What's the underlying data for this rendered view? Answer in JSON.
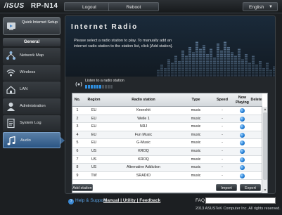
{
  "header": {
    "logo": "/ISUS",
    "model": "RP-N14",
    "logout_label": "Logout",
    "reboot_label": "Reboot",
    "language": "English"
  },
  "sidebar": {
    "quick_setup": "Quick Internet Setup",
    "general_label": "General",
    "items": [
      {
        "label": "Network Map",
        "icon": "network-map-icon"
      },
      {
        "label": "Wireless",
        "icon": "wireless-icon"
      },
      {
        "label": "LAN",
        "icon": "lan-icon"
      },
      {
        "label": "Administration",
        "icon": "administration-icon"
      },
      {
        "label": "System Log",
        "icon": "system-log-icon"
      },
      {
        "label": "Audio",
        "icon": "audio-icon",
        "active": true
      }
    ]
  },
  "main": {
    "title": "Internet Radio",
    "description": "Please select a radio station to play. To manually add an internet radio station to the station list, click [Add station].",
    "player_label": "Listen to a radio station",
    "volume": 0.6,
    "table": {
      "columns": [
        "No.",
        "Region",
        "Radio station",
        "Type",
        "Speed",
        "Now Playing",
        "Delete"
      ],
      "rows": [
        {
          "no": "1",
          "region": "EU",
          "station": "Kronehit",
          "type": "music",
          "speed": "-"
        },
        {
          "no": "2",
          "region": "EU",
          "station": "Welle 1",
          "type": "music",
          "speed": "-"
        },
        {
          "no": "3",
          "region": "EU",
          "station": "NRJ",
          "type": "music",
          "speed": "-"
        },
        {
          "no": "4",
          "region": "EU",
          "station": "Fun Music",
          "type": "music",
          "speed": "-"
        },
        {
          "no": "5",
          "region": "EU",
          "station": "G-Music",
          "type": "music",
          "speed": "-"
        },
        {
          "no": "6",
          "region": "US",
          "station": "KROQ",
          "type": "music",
          "speed": "-"
        },
        {
          "no": "7",
          "region": "US",
          "station": "KROQ",
          "type": "music",
          "speed": "-"
        },
        {
          "no": "8",
          "region": "US",
          "station": "Alternative Addiction",
          "type": "music",
          "speed": "-"
        },
        {
          "no": "9",
          "region": "TW",
          "station": "SRADIO",
          "type": "music",
          "speed": "-"
        }
      ]
    },
    "add_station_label": "Add station",
    "import_label": "Import",
    "export_label": "Export"
  },
  "footer": {
    "help_label": "Help & Support",
    "links": "Manual | Utility | Feedback",
    "faq_label": "FAQ",
    "copyright": "2013 ASUSTeK Computer Inc. All rights reserved."
  },
  "colors": {
    "accent": "#2b5584",
    "play": "#1a78d2",
    "link": "#5aa3e6"
  }
}
